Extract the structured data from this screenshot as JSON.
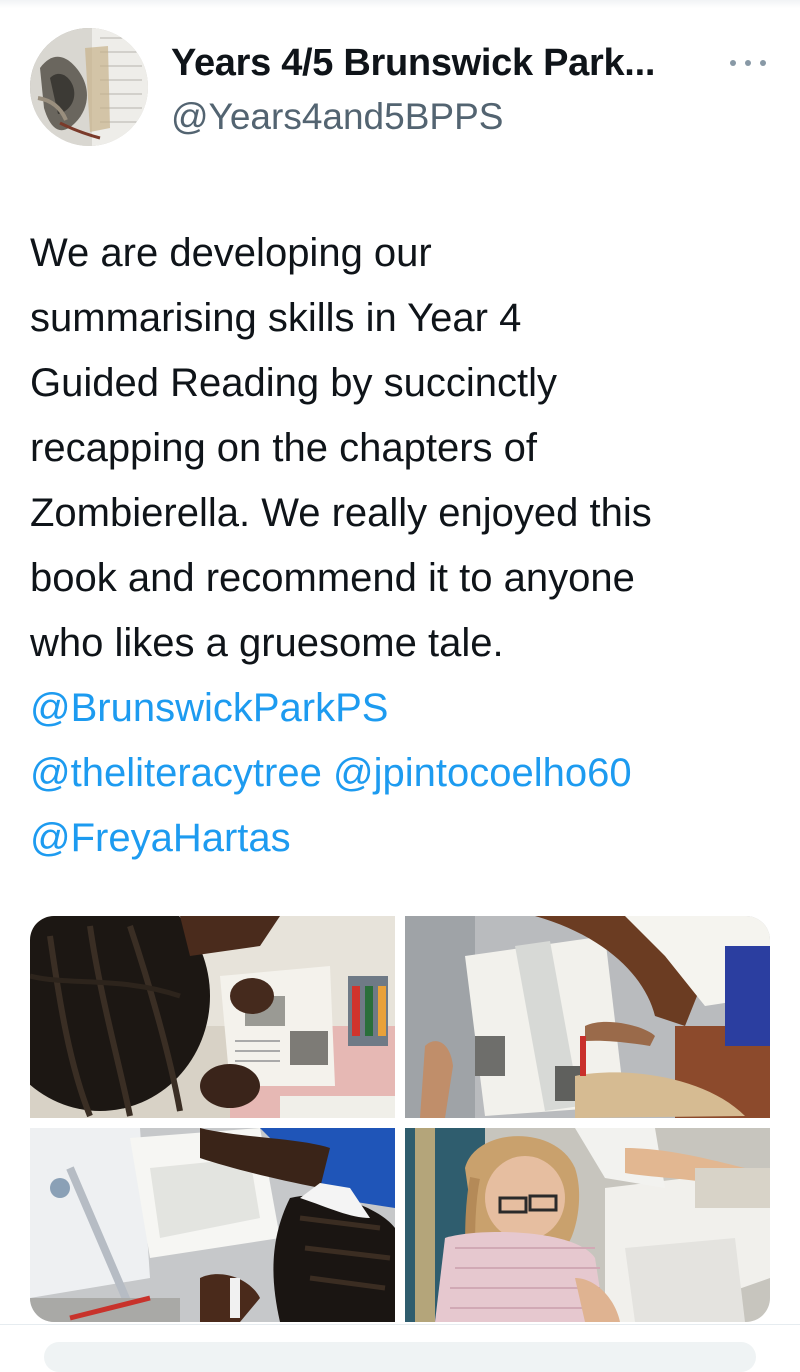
{
  "tweet": {
    "display_name": "Years 4/5 Brunswick Park...",
    "handle": "@Years4and5BPPS",
    "more_icon": "more-horizontal-icon",
    "text_lines": [
      "We are developing our",
      "summarising skills in Year 4",
      "Guided Reading by succinctly",
      "recapping on the chapters of",
      "Zombierella. We really enjoyed this",
      "book and recommend it to anyone",
      "who likes a gruesome tale."
    ],
    "mentions": {
      "brunswick": "@BrunswickParkPS",
      "literacytree": "@theliteracytree",
      "jpinto": "@jpintocoelho60",
      "freya": "@FreyaHartas"
    }
  },
  "colors": {
    "text": "#0f1419",
    "secondary": "#536471",
    "link": "#1d9bf0"
  }
}
